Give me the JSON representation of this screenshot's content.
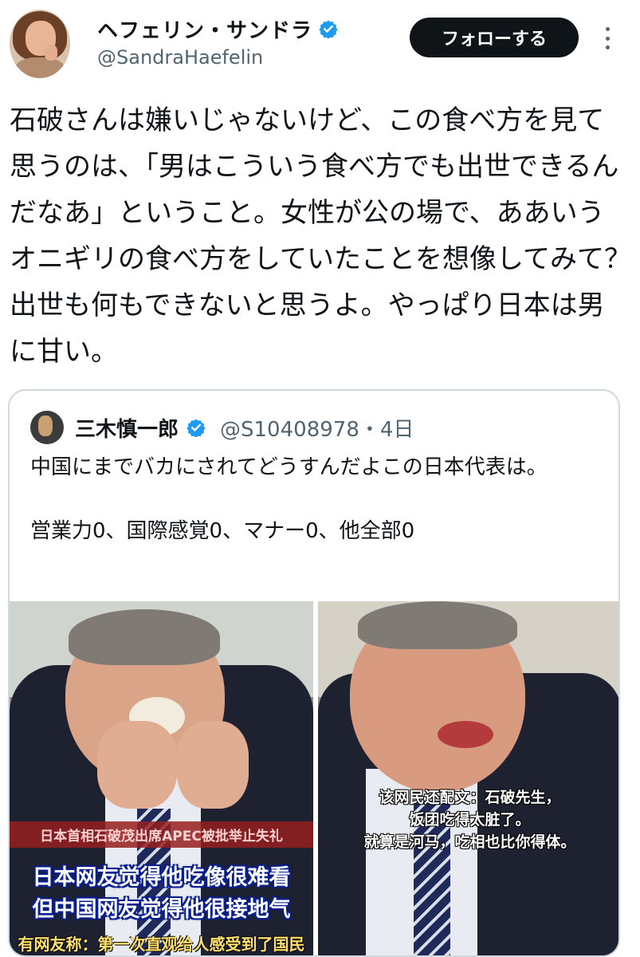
{
  "header": {
    "display_name": "ヘフェリン・サンドラ",
    "handle": "@SandraHaefelin",
    "follow_label": "フォローする",
    "verified_icon": "verified-badge-icon",
    "more_icon": "more-vertical-icon"
  },
  "tweet": {
    "text": "石破さんは嫌いじゃないけど、この食べ方を見て思うのは、「男はこういう食べ方でも出世できるんだなあ」ということ。女性が公の場で、ああいうオニギリの食べ方をしていたことを想像してみて？出世も何もできないと思うよ。やっぱり日本は男に甘い。"
  },
  "quote": {
    "name": "三木慎一郎",
    "handle_time": "@S10408978・4日",
    "lines": [
      "中国にまでバカにされてどうすんだよこの日本代表は。",
      "",
      "営業力0、国際感覚0、マナー0、他全部0"
    ],
    "media": {
      "left": {
        "caption_red": "日本首相石破茂出席APEC被批举止失礼",
        "caption_line1": "日本网友觉得他吃像很难看",
        "caption_line2": "但中国网友觉得他很接地气",
        "caption_bottom": "有网友称：第一次直观给人感受到了国民"
      },
      "right": {
        "caption_line1": "该网民还配文：石破先生，",
        "caption_line2": "饭团吃得太脏了。",
        "caption_line3": "就算是河马，吃相也比你得体。"
      }
    }
  },
  "colors": {
    "text": "#0f1419",
    "secondary": "#536471",
    "verified": "#1d9bf0",
    "border": "#cfd9de",
    "follow_bg": "#0f1419"
  }
}
